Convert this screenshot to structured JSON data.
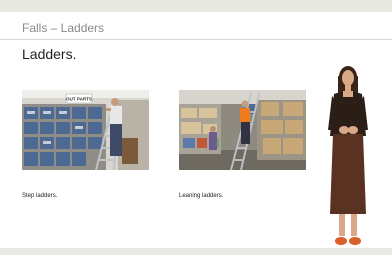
{
  "header": {
    "section_title": "Falls – Ladders"
  },
  "slide": {
    "title": "Ladders.",
    "items": [
      {
        "caption": "Step ladders.",
        "sign_text": "OUT PARTS"
      },
      {
        "caption": "Leaning ladders."
      }
    ]
  },
  "colors": {
    "background": "#e9e9e4",
    "slide": "#ffffff",
    "safety_vest": "#f07a1e",
    "blue_bins": "#4c6a94"
  }
}
